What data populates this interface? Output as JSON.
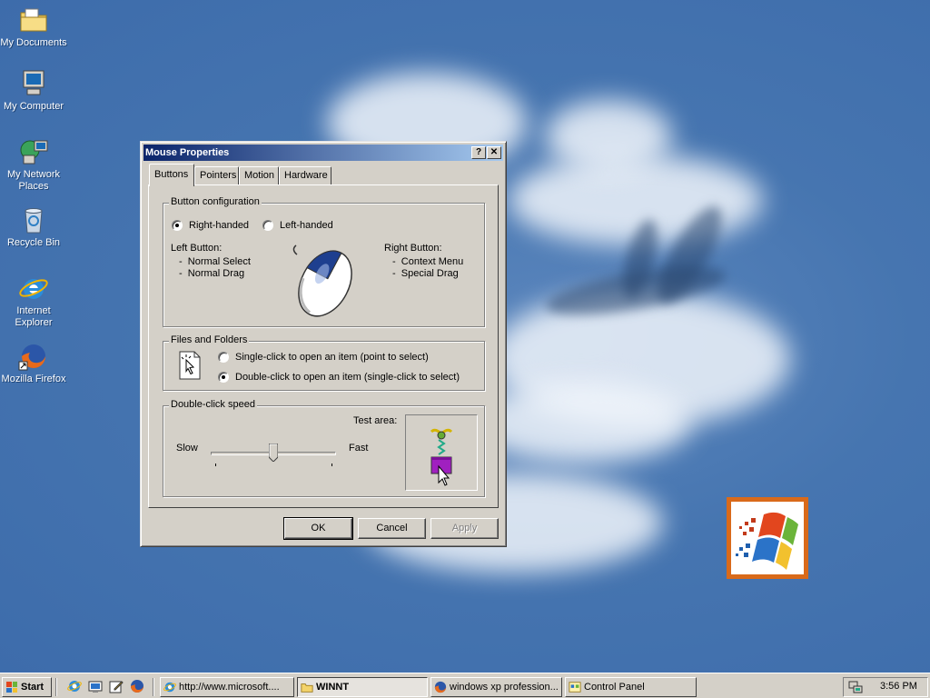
{
  "desktop": {
    "icons": [
      {
        "label": "My Documents",
        "icon": "folder-icon"
      },
      {
        "label": "My Computer",
        "icon": "computer-icon"
      },
      {
        "label": "My Network Places",
        "icon": "network-icon"
      },
      {
        "label": "Recycle Bin",
        "icon": "recycle-bin-icon"
      },
      {
        "label": "Internet Explorer",
        "icon": "internet-explorer-icon"
      },
      {
        "label": "Mozilla Firefox",
        "icon": "firefox-icon"
      }
    ]
  },
  "dialog": {
    "title": "Mouse Properties",
    "help_glyph": "?",
    "close_glyph": "✕",
    "tabs": [
      "Buttons",
      "Pointers",
      "Motion",
      "Hardware"
    ],
    "active_tab": "Buttons",
    "button_config": {
      "title": "Button configuration",
      "right_handed": "Right-handed",
      "left_handed": "Left-handed",
      "selected": "Right-handed",
      "left_button_heading": "Left Button:",
      "left_button_items": [
        "Normal Select",
        "Normal Drag"
      ],
      "right_button_heading": "Right Button:",
      "right_button_items": [
        "Context Menu",
        "Special Drag"
      ],
      "bullet": "-"
    },
    "files_folders": {
      "title": "Files and Folders",
      "single_click": "Single-click to open an item (point to select)",
      "double_click": "Double-click to open an item (single-click to select)",
      "selected": "Double-click to open an item (single-click to select)"
    },
    "double_click_speed": {
      "title": "Double-click speed",
      "slow": "Slow",
      "fast": "Fast",
      "test_area": "Test area:",
      "slider_fraction": 0.5
    },
    "buttons": {
      "ok": "OK",
      "cancel": "Cancel",
      "apply": "Apply"
    }
  },
  "taskbar": {
    "start": "Start",
    "quick_launch": [
      "internet-explorer-icon",
      "show-desktop-icon",
      "edit-icon",
      "firefox-icon"
    ],
    "tasks": [
      {
        "label": "http://www.microsoft....",
        "icon": "internet-explorer-icon",
        "pressed": false
      },
      {
        "label": "WINNT",
        "icon": "folder-icon",
        "pressed": true
      },
      {
        "label": "windows xp profession...",
        "icon": "firefox-icon",
        "pressed": false
      },
      {
        "label": "Control Panel",
        "icon": "control-panel-icon",
        "pressed": false
      }
    ],
    "clock": "3:56 PM"
  },
  "colors": {
    "desktop": "#3a6ea5",
    "titlebar_start": "#0a246a",
    "titlebar_end": "#a6caf0",
    "face": "#d4d0c8",
    "logo_border": "#d96a1a"
  }
}
